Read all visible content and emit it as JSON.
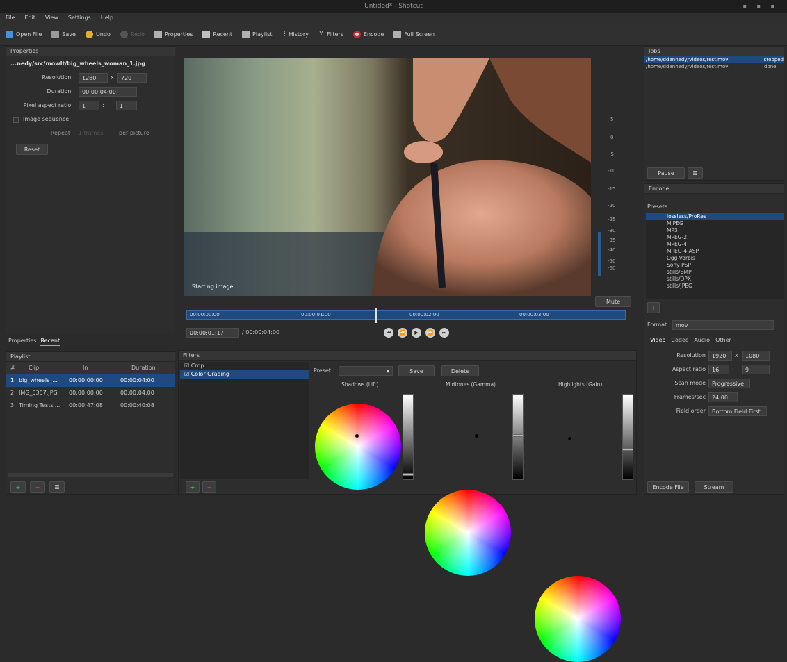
{
  "window": {
    "title": "Untitled* - Shotcut"
  },
  "menu": [
    "File",
    "Edit",
    "View",
    "Settings",
    "Help"
  ],
  "toolbar": [
    {
      "label": "Open File",
      "icon": "folder-icon",
      "color": "#4a90d9"
    },
    {
      "label": "Save",
      "icon": "save-icon",
      "color": "#9a9a9a"
    },
    {
      "label": "Undo",
      "icon": "undo-icon",
      "color": "#e0b030"
    },
    {
      "label": "Redo",
      "icon": "redo-icon",
      "color": "#666666"
    },
    {
      "label": "Properties",
      "icon": "properties-icon",
      "color": "#aaaaaa"
    },
    {
      "label": "Recent",
      "icon": "recent-icon",
      "color": "#aaaaaa"
    },
    {
      "label": "Playlist",
      "icon": "playlist-icon",
      "color": "#aaaaaa"
    },
    {
      "label": "History",
      "icon": "history-icon",
      "color": "#aaaaaa"
    },
    {
      "label": "Filters",
      "icon": "filters-icon",
      "color": "#aaaaaa"
    },
    {
      "label": "Encode",
      "icon": "encode-icon",
      "color": "#dddddd"
    },
    {
      "label": "Full Screen",
      "icon": "fullscreen-icon",
      "color": "#aaaaaa"
    }
  ],
  "properties": {
    "header": "Properties",
    "filename": "...nedy/src/mowlt/big_wheels_woman_1.jpg",
    "resolution_label": "Resolution:",
    "res_w": "1280",
    "res_x": "x",
    "res_h": "720",
    "duration_label": "Duration:",
    "duration": "00:00:04:00",
    "par_label": "Pixel aspect ratio:",
    "par_a": "1",
    "par_b": "1",
    "image_sequence": "Image sequence",
    "repeat_label": "Repeat",
    "repeat_value": "1 frames",
    "per_picture": "per picture",
    "reset": "Reset"
  },
  "lefttabs": [
    "Properties",
    "Recent"
  ],
  "playlist": {
    "header": "Playlist",
    "columns": [
      "#",
      "Clip",
      "In",
      "Duration"
    ],
    "rows": [
      {
        "n": "1",
        "clip": "big_wheels_...",
        "in": "00:00:00:00",
        "dur": "00:00:04:00"
      },
      {
        "n": "2",
        "clip": "IMG_0357.JPG",
        "in": "00:00:00:00",
        "dur": "00:00:04:00"
      },
      {
        "n": "3",
        "clip": "Timing Testsl...",
        "in": "00:00:47:08",
        "dur": "00:00:40:08"
      }
    ]
  },
  "viewer": {
    "overlay": "Starting image",
    "timecode": "00:00:01:17",
    "total": "/ 00:00:04:00",
    "ruler": [
      "00:00:00:00",
      "00:00:01:00",
      "00:00:02:00",
      "00:00:03:00"
    ],
    "playhead_fraction": 0.43
  },
  "audiometer": {
    "ticks": [
      "5",
      "0",
      "-5",
      "-10",
      "-15",
      "-20",
      "-25",
      "-30",
      "-35",
      "-40",
      "-50",
      "-60"
    ],
    "mute": "Mute"
  },
  "filters": {
    "header": "Filters",
    "items": [
      {
        "label": "Crop",
        "checked": true,
        "selected": false
      },
      {
        "label": "Color Grading",
        "checked": true,
        "selected": true
      }
    ],
    "preset_label": "Preset",
    "save": "Save",
    "delete": "Delete",
    "wheels": [
      {
        "label": "Shadows (Lift)",
        "slider_level": 0.05
      },
      {
        "label": "Midtones (Gamma)",
        "slider_level": 0.52
      },
      {
        "label": "Highlights (Gain)",
        "slider_level": 0.35
      }
    ]
  },
  "jobs": {
    "header": "Jobs",
    "rows": [
      {
        "path": "/home/ddennedy/Videos/test.mov",
        "status": "stopped"
      },
      {
        "path": "/home/ddennedy/Videos/test.mov",
        "status": "done"
      }
    ],
    "pause": "Pause"
  },
  "encode": {
    "header": "Encode",
    "presets_label": "Presets",
    "presets": [
      "lossless/ProRes",
      "MJPEG",
      "MP3",
      "MPEG-2",
      "MPEG-4",
      "MPEG-4-ASP",
      "Ogg Vorbis",
      "Sony-PSP",
      "stills/BMP",
      "stills/DPX",
      "stills/JPEG"
    ],
    "format_label": "Format",
    "format_value": "mov",
    "tabs": [
      "Video",
      "Codec",
      "Audio",
      "Other"
    ],
    "resolution_label": "Resolution",
    "res_w": "1920",
    "res_h": "1080",
    "aspect_label": "Aspect ratio",
    "aspect_a": "16",
    "aspect_b": "9",
    "scan_label": "Scan mode",
    "scan_value": "Progressive",
    "fps_label": "Frames/sec",
    "fps_value": "24.00",
    "field_label": "Field order",
    "field_value": "Bottom Field First",
    "encode_file": "Encode File",
    "stream": "Stream"
  },
  "colors": {
    "accent": "#2e5a8e",
    "selection": "#1f4a80"
  }
}
